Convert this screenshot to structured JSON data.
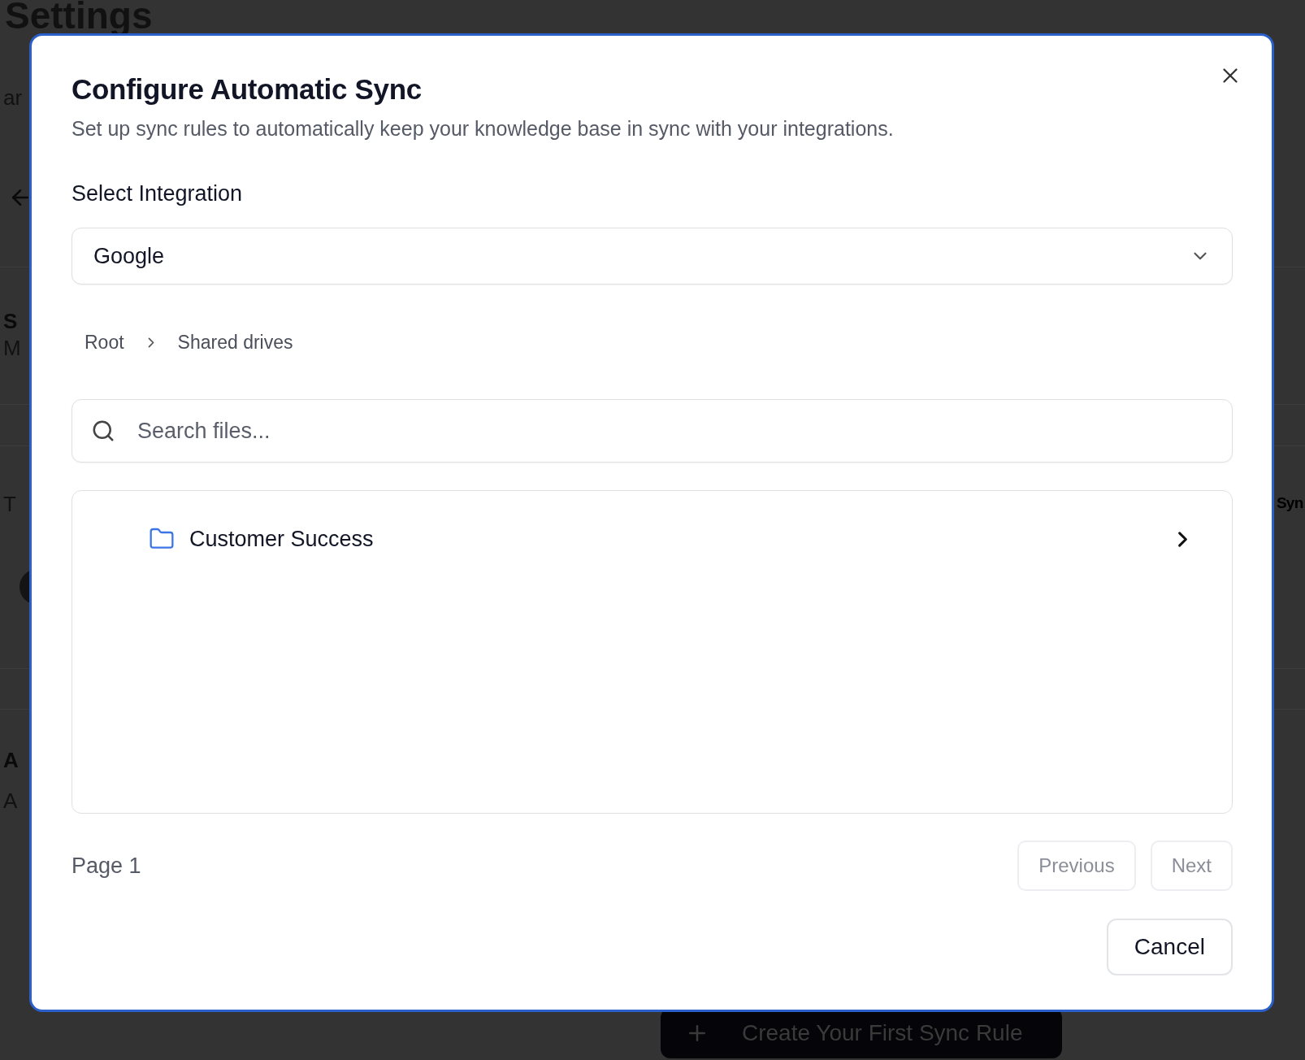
{
  "background": {
    "heading": "Settings",
    "fragments": [
      {
        "text": "ar",
        "kind": "muted"
      },
      {
        "text": "S",
        "kind": "bold"
      },
      {
        "text": "M",
        "kind": "muted"
      },
      {
        "text": "T",
        "kind": "muted"
      },
      {
        "text": "A",
        "kind": "bold"
      },
      {
        "text": "A",
        "kind": "muted"
      }
    ],
    "right_fragment": "Syn",
    "create_button": {
      "label": "Create Your First Sync Rule"
    }
  },
  "dialog": {
    "title": "Configure Automatic Sync",
    "subtitle": "Set up sync rules to automatically keep your knowledge base in sync with your integrations.",
    "integration": {
      "label": "Select Integration",
      "value": "Google"
    },
    "breadcrumb": [
      "Root",
      "Shared drives"
    ],
    "search": {
      "placeholder": "Search files..."
    },
    "items": [
      {
        "name": "Customer Success",
        "kind": "folder"
      }
    ],
    "page_label": "Page 1",
    "pagination": [
      {
        "label": "Previous",
        "disabled": true
      },
      {
        "label": "Next",
        "disabled": true
      }
    ],
    "cancel": "Cancel"
  }
}
